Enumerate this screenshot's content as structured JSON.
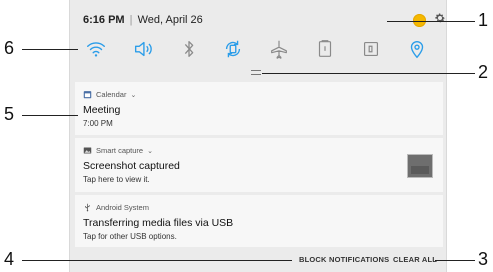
{
  "status_bar": {
    "time": "6:16 PM",
    "separator": "|",
    "date": "Wed, April 26"
  },
  "quick_settings": [
    {
      "name": "wifi",
      "active": true
    },
    {
      "name": "sound",
      "active": true
    },
    {
      "name": "bluetooth",
      "active": false
    },
    {
      "name": "auto-rotate",
      "active": true
    },
    {
      "name": "airplane-mode",
      "active": false
    },
    {
      "name": "flashlight",
      "active": false
    },
    {
      "name": "power-saving",
      "active": false
    },
    {
      "name": "location",
      "active": true
    }
  ],
  "notifications": [
    {
      "app": "Calendar",
      "icon": "calendar-icon",
      "title": "Meeting",
      "text": "7:00 PM",
      "chevron": "⌄"
    },
    {
      "app": "Smart capture",
      "icon": "image-icon",
      "title": "Screenshot captured",
      "text": "Tap here to view it.",
      "chevron": "⌄"
    },
    {
      "app": "Android System",
      "icon": "usb-icon",
      "title": "Transferring media files via USB",
      "text": "Tap for other USB options."
    }
  ],
  "footer": {
    "block_label": "BLOCK NOTIFICATIONS",
    "clear_label": "CLEAR ALL"
  },
  "callouts": [
    "1",
    "2",
    "3",
    "4",
    "5",
    "6"
  ],
  "colors": {
    "accent": "#2b9de9",
    "inactive": "#8a8a8a",
    "panel_bg": "#ebebeb",
    "card_bg": "#f7f7f7",
    "dot": "#f5b800"
  }
}
